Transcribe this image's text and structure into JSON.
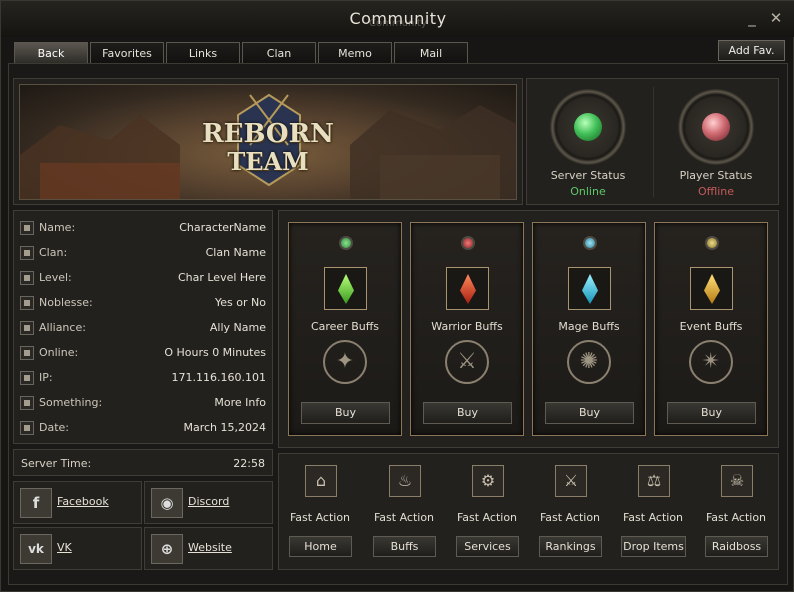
{
  "window": {
    "title": "Community",
    "ghost_title": "Community",
    "minimize_glyph": "_",
    "close_glyph": "✕"
  },
  "tabs": [
    {
      "label": "Back",
      "active": true
    },
    {
      "label": "Favorites"
    },
    {
      "label": "Links"
    },
    {
      "label": "Clan"
    },
    {
      "label": "Memo"
    },
    {
      "label": "Mail"
    }
  ],
  "add_fav_label": "Add Fav.",
  "banner": {
    "logo_line1": "REBORN",
    "logo_line2": "TEAM"
  },
  "status": {
    "server": {
      "label": "Server Status",
      "value": "Online",
      "color": "#5cc96a"
    },
    "player": {
      "label": "Player Status",
      "value": "Offline",
      "color": "#c35b5b"
    }
  },
  "character_info": [
    {
      "label": "Name:",
      "value": "CharacterName"
    },
    {
      "label": "Clan:",
      "value": "Clan Name"
    },
    {
      "label": "Level:",
      "value": "Char Level Here"
    },
    {
      "label": "Noblesse:",
      "value": "Yes or No"
    },
    {
      "label": "Alliance:",
      "value": "Ally Name"
    },
    {
      "label": "Online:",
      "value": "O Hours 0 Minutes"
    },
    {
      "label": "IP:",
      "value": "171.116.160.101"
    },
    {
      "label": "Something:",
      "value": "More Info"
    },
    {
      "label": "Date:",
      "value": "March 15,2024"
    }
  ],
  "server_time": {
    "label": "Server Time:",
    "value": "22:58"
  },
  "social": [
    {
      "label": "Facebook",
      "icon": "facebook-icon",
      "glyph": "f"
    },
    {
      "label": "Discord",
      "icon": "discord-icon",
      "glyph": "◉"
    },
    {
      "label": "VK",
      "icon": "vk-icon",
      "glyph": "vk"
    },
    {
      "label": "Website",
      "icon": "globe-icon",
      "glyph": "⊕"
    }
  ],
  "buffs": [
    {
      "name": "Career Buffs",
      "buy_label": "Buy",
      "dot_color": "#3fa34d",
      "crystal_color": "#6fd13f",
      "emblem": "crown-emblem",
      "emblem_glyph": "✦"
    },
    {
      "name": "Warrior Buffs",
      "buy_label": "Buy",
      "dot_color": "#b23a3a",
      "crystal_color": "#e0402a",
      "emblem": "axe-emblem",
      "emblem_glyph": "⚔"
    },
    {
      "name": "Mage Buffs",
      "buy_label": "Buy",
      "dot_color": "#3a9fb8",
      "crystal_color": "#2fc4e0",
      "emblem": "mage-emblem",
      "emblem_glyph": "✺"
    },
    {
      "name": "Event Buffs",
      "buy_label": "Buy",
      "dot_color": "#b5a048",
      "crystal_color": "#e6b22b",
      "emblem": "star-emblem",
      "emblem_glyph": "✴"
    }
  ],
  "fast_actions": [
    {
      "label": "Fast Action",
      "button": "Home",
      "icon": "home-icon",
      "glyph": "⌂"
    },
    {
      "label": "Fast Action",
      "button": "Buffs",
      "icon": "buff-icon",
      "glyph": "♨"
    },
    {
      "label": "Fast Action",
      "button": "Services",
      "icon": "gear-icon",
      "glyph": "⚙"
    },
    {
      "label": "Fast Action",
      "button": "Rankings",
      "icon": "swords-icon",
      "glyph": "⚔"
    },
    {
      "label": "Fast Action",
      "button": "Drop Items",
      "icon": "scales-icon",
      "glyph": "⚖"
    },
    {
      "label": "Fast Action",
      "button": "Raidboss",
      "icon": "dragon-icon",
      "glyph": "☠"
    }
  ]
}
